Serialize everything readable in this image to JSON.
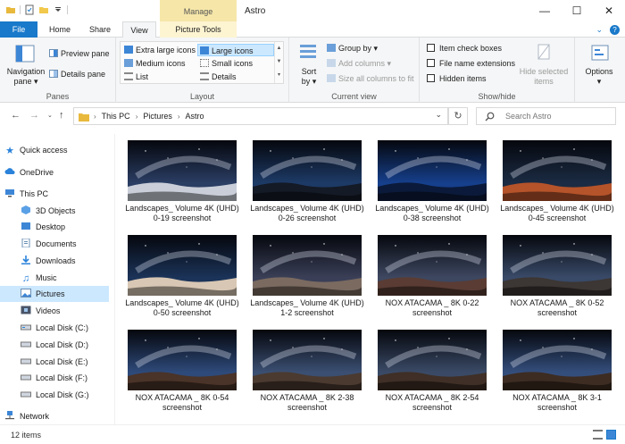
{
  "window": {
    "title": "Astro",
    "context_tab": "Manage"
  },
  "window_controls": {
    "minimize": "—",
    "maximize": "☐",
    "close": "✕"
  },
  "tabs": [
    {
      "label": "File"
    },
    {
      "label": "Home"
    },
    {
      "label": "Share"
    },
    {
      "label": "View"
    },
    {
      "label": "Picture Tools"
    }
  ],
  "ribbon": {
    "panes": {
      "label": "Panes",
      "navigation_pane": "Navigation",
      "navigation_pane_2": "pane ▾",
      "preview_pane": "Preview pane",
      "details_pane": "Details pane"
    },
    "layout": {
      "label": "Layout",
      "extra_large": "Extra large icons",
      "large": "Large icons",
      "medium": "Medium icons",
      "small": "Small icons",
      "list": "List",
      "details": "Details"
    },
    "current_view": {
      "label": "Current view",
      "sort_by": "Sort",
      "sort_by_2": "by ▾",
      "group_by": "Group by ▾",
      "add_columns": "Add columns ▾",
      "size_all": "Size all columns to fit"
    },
    "show_hide": {
      "label": "Show/hide",
      "item_check_boxes": "Item check boxes",
      "file_name_extensions": "File name extensions",
      "hidden_items": "Hidden items",
      "hide_selected": "Hide selected",
      "hide_selected_2": "items"
    },
    "options": {
      "label": "Options",
      "caret": "▾"
    }
  },
  "address": {
    "crumbs": [
      "This PC",
      "Pictures",
      "Astro"
    ],
    "dropdown": "⌄",
    "refresh": "↻"
  },
  "search": {
    "placeholder": "Search Astro"
  },
  "sidebar": {
    "items": [
      {
        "label": "Quick access"
      },
      {
        "label": "OneDrive"
      },
      {
        "label": "This PC"
      },
      {
        "label": "3D Objects"
      },
      {
        "label": "Desktop"
      },
      {
        "label": "Documents"
      },
      {
        "label": "Downloads"
      },
      {
        "label": "Music"
      },
      {
        "label": "Pictures"
      },
      {
        "label": "Videos"
      },
      {
        "label": "Local Disk (C:)"
      },
      {
        "label": "Local Disk (D:)"
      },
      {
        "label": "Local Disk (E:)"
      },
      {
        "label": "Local Disk (F:)"
      },
      {
        "label": "Local Disk (G:)"
      },
      {
        "label": "Network"
      }
    ]
  },
  "files": [
    {
      "line1": "Landscapes_ Volume 4K (UHD)",
      "line2": "0-19 screenshot",
      "sky": "#2a3d63",
      "ground": "#c9ced8"
    },
    {
      "line1": "Landscapes_ Volume 4K (UHD)",
      "line2": "0-26 screenshot",
      "sky": "#1d3a66",
      "ground": "#141a26"
    },
    {
      "line1": "Landscapes_ Volume 4K (UHD)",
      "line2": "0-38 screenshot",
      "sky": "#163f8c",
      "ground": "#0b1a3a"
    },
    {
      "line1": "Landscapes_ Volume 4K (UHD)",
      "line2": "0-45 screenshot",
      "sky": "#1b2b43",
      "ground": "#b5532a"
    },
    {
      "line1": "Landscapes_ Volume 4K (UHD)",
      "line2": "0-50 screenshot",
      "sky": "#1b3358",
      "ground": "#d8c7b4"
    },
    {
      "line1": "Landscapes_ Volume 4K (UHD)",
      "line2": "1-2 screenshot",
      "sky": "#3a3f57",
      "ground": "#7a6a60"
    },
    {
      "line1": "NOX ATACAMA _ 8K 0-22",
      "line2": "screenshot",
      "sky": "#3d4760",
      "ground": "#5a3c34"
    },
    {
      "line1": "NOX ATACAMA _ 8K 0-52",
      "line2": "screenshot",
      "sky": "#394a68",
      "ground": "#3c3634"
    },
    {
      "line1": "NOX ATACAMA _ 8K 0-54",
      "line2": "screenshot",
      "sky": "#2e4a7a",
      "ground": "#4a3328"
    },
    {
      "line1": "NOX ATACAMA _ 8K 2-38",
      "line2": "screenshot",
      "sky": "#3b4f72",
      "ground": "#4b3a30"
    },
    {
      "line1": "NOX ATACAMA _ 8K 2-54",
      "line2": "screenshot",
      "sky": "#3a4a66",
      "ground": "#3f2f26"
    },
    {
      "line1": "NOX ATACAMA _ 8K 3-1",
      "line2": "screenshot",
      "sky": "#344e7c",
      "ground": "#3d2c22"
    }
  ],
  "status": {
    "count": "12 items"
  },
  "colors": {
    "accent": "#1979ca",
    "selection": "#cce8ff",
    "manage_tab": "#f6e7a9"
  }
}
